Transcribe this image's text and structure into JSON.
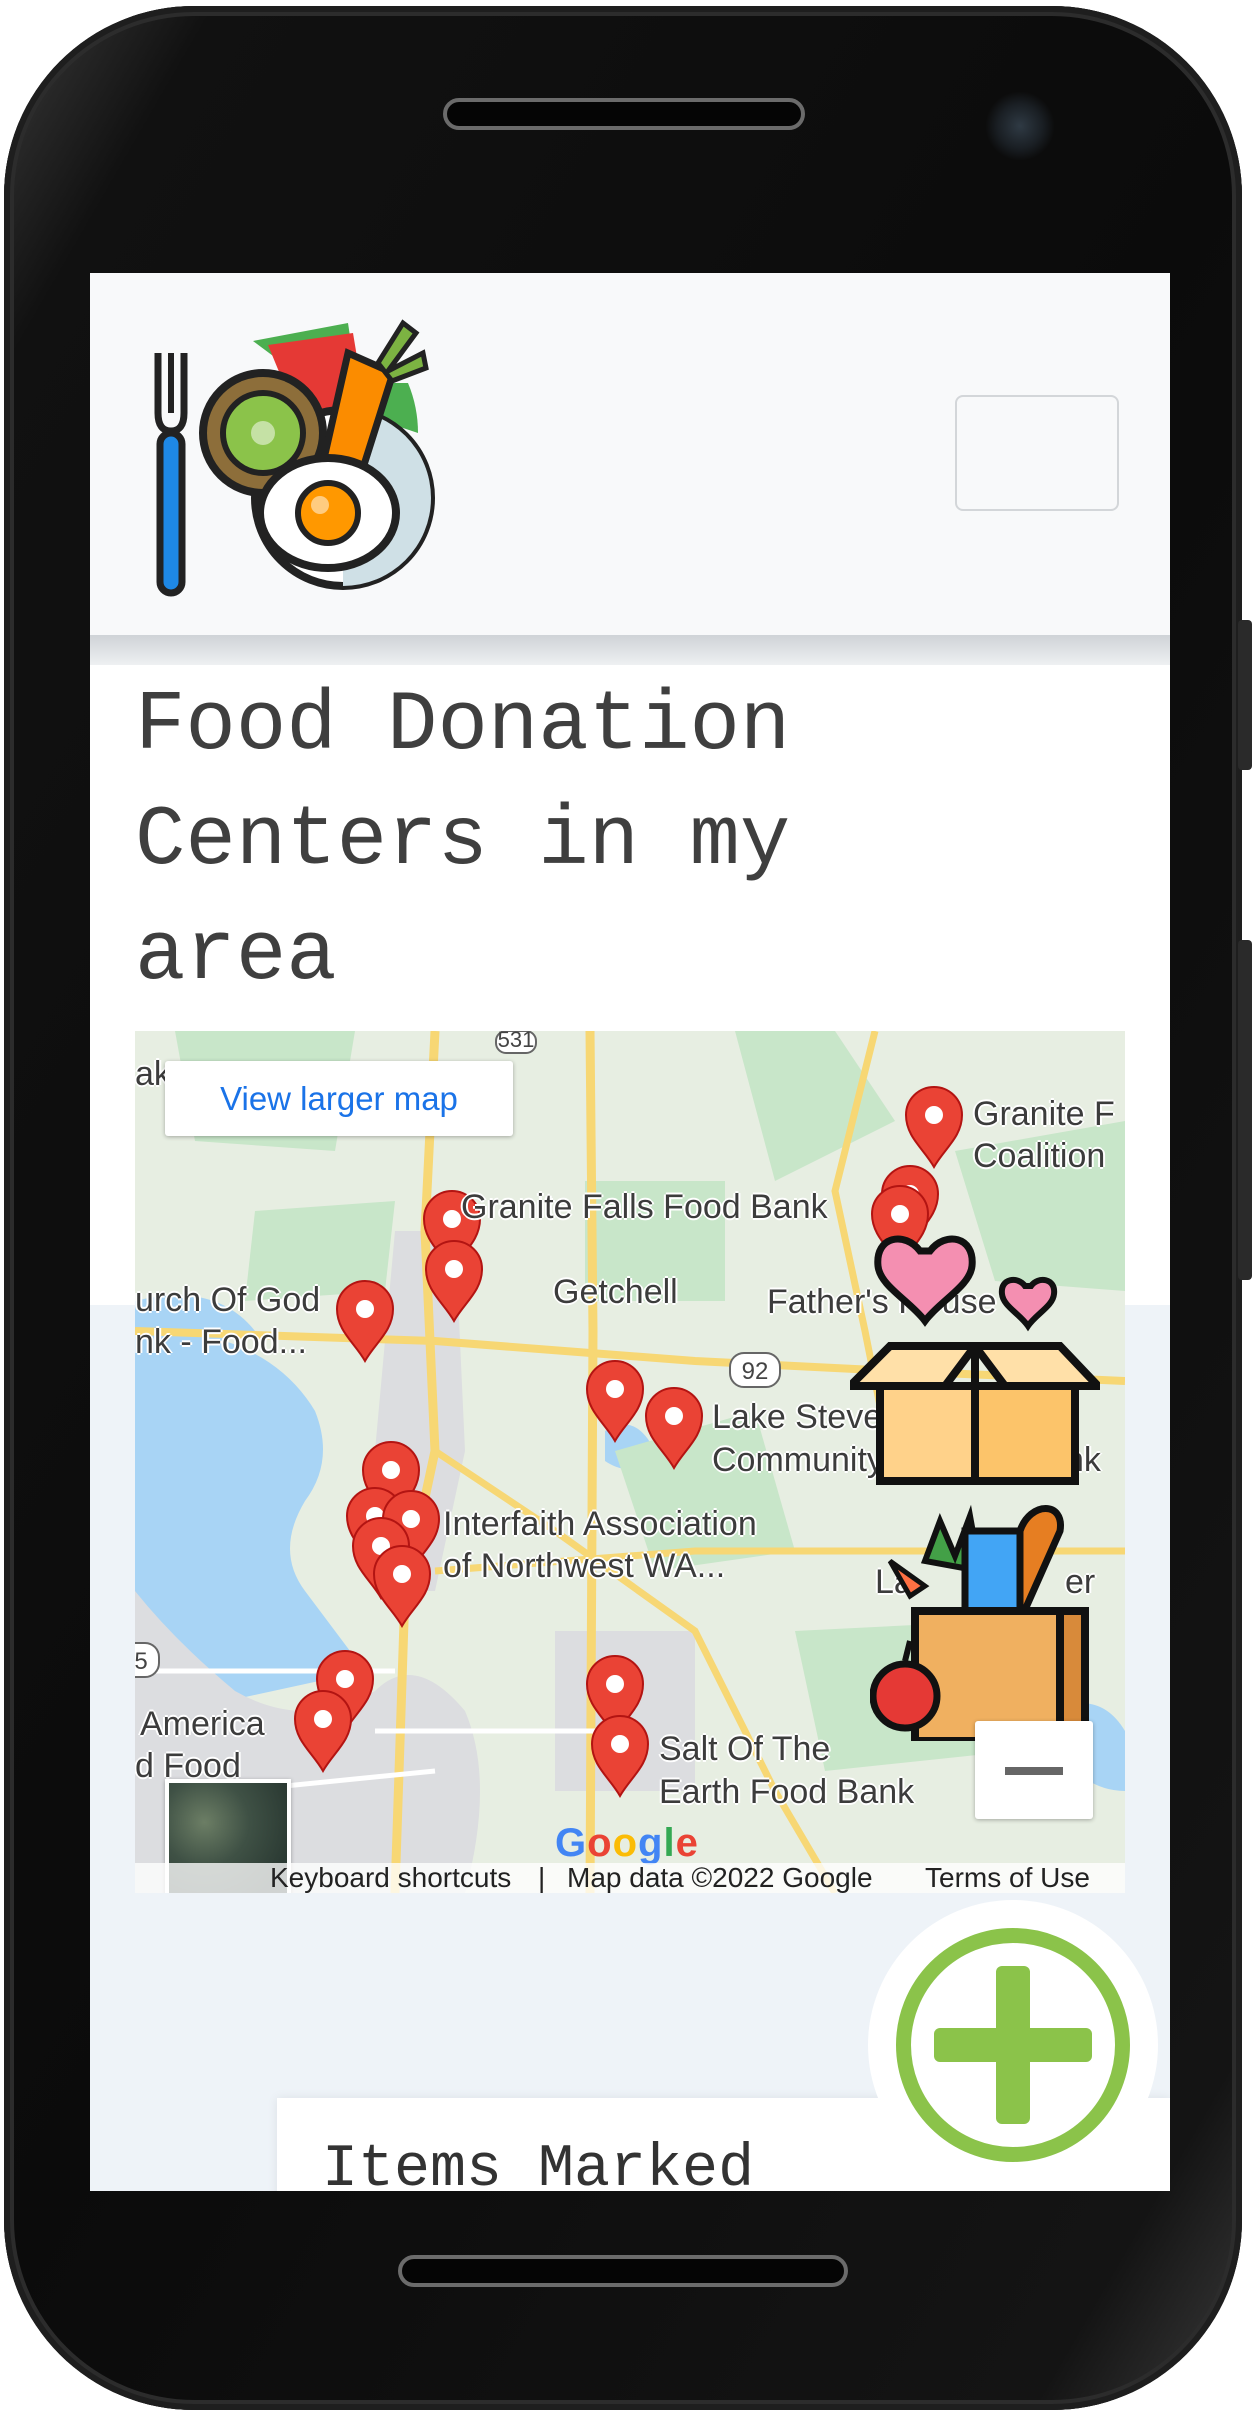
{
  "navbar": {
    "logo_alt": "Food plate logo",
    "menu_toggle_label": ""
  },
  "page": {
    "title": "Food Donation Centers in my area"
  },
  "map": {
    "view_larger_label": "View larger map",
    "place_labels": [
      "Granite Falls Food Bank",
      "Getchell",
      "Father's House",
      "urch Of God",
      "nk - Food...",
      "Lake Steve",
      "Community",
      "nk",
      "Interfaith Association",
      "of Northwest WA...",
      "La",
      "er",
      "America",
      "d Food",
      "Salt Of The",
      "Earth Food Bank",
      "Granite F",
      "Coalition",
      "ak"
    ],
    "road_shields": [
      "531",
      "92",
      "5"
    ],
    "google_logo": "Google",
    "attribution": {
      "keyboard_shortcuts": "Keyboard shortcuts",
      "separator": "|",
      "map_data": "Map data ©2022 Google",
      "terms": "Terms of Use"
    },
    "zoom_out_label": "−",
    "colors": {
      "water": "#a8d4f5",
      "land": "#e7eee2",
      "park": "#c8e6c9",
      "marker": "#ea4335",
      "road": "#f7d774"
    }
  },
  "items_section": {
    "title": "Items Marked"
  },
  "fab": {
    "icon": "plus-icon",
    "color": "#8bc34a"
  }
}
